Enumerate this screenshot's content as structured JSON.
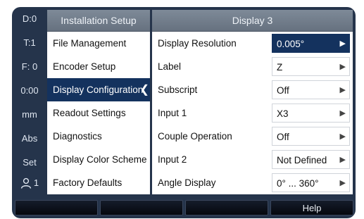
{
  "status_strip": {
    "items": [
      "D:0",
      "T:1",
      "F:  0",
      "0:00",
      "mm",
      "Abs",
      "Set"
    ],
    "user_number": "1",
    "user_icon": "user-icon"
  },
  "left_panel": {
    "title": "Installation Setup",
    "items": [
      "File Management",
      "Encoder Setup",
      "Display Configuration",
      "Readout Settings",
      "Diagnostics",
      "Display Color Scheme",
      "Factory Defaults"
    ],
    "active_index": 2
  },
  "right_panel": {
    "title": "Display 3",
    "rows": [
      {
        "label": "Display Resolution",
        "value": "0.005°"
      },
      {
        "label": "Label",
        "value": "Z"
      },
      {
        "label": "Subscript",
        "value": "Off"
      },
      {
        "label": "Input 1",
        "value": "X3"
      },
      {
        "label": "Couple Operation",
        "value": "Off"
      },
      {
        "label": "Input 2",
        "value": "Not Defined"
      },
      {
        "label": "Angle Display",
        "value": "0° ... 360°"
      }
    ],
    "selected_index": 0
  },
  "softkeys": [
    "",
    "",
    "",
    "Help"
  ],
  "colors": {
    "background": "#25344b",
    "selected": "#14325e",
    "header": "#747f8d"
  }
}
